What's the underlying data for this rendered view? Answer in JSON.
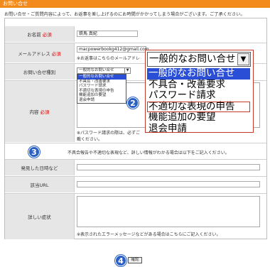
{
  "header": {
    "title": "お問い合せ"
  },
  "intro": "お問い合せ・ご質問内容によって、お返事を差し上げるのにお時間がかかってしまう場合がございます。ご了承ください。",
  "form": {
    "required_mark": "必須",
    "name": {
      "label": "お名前",
      "value": "鉄馬 真紀"
    },
    "email": {
      "label": "メールアドレス",
      "value": "macpowerbookg412@gmail.com",
      "note": "※お返事はこちらのメールアドレ"
    },
    "type": {
      "label": "お問い合せ種別",
      "selected": "一般的なお問い合せ",
      "options": [
        "一般的なお問い合せ",
        "不具合・改善要求",
        "パスワード請求",
        "不適切な表現の申告",
        "機能追加の要望",
        "退会申請"
      ]
    },
    "content": {
      "label": "内容",
      "note": "※パスワード請求の際は、必ずご",
      "note2": "載ください。"
    },
    "section_note": "不具合報告や不適切な表現など、詳しい情報がわかる場合は以下をご記入ください。",
    "found_datetime": {
      "label": "発見した日時など"
    },
    "url": {
      "label": "該当URL"
    },
    "detail": {
      "label": "詳しい症状",
      "note": "※表示されたエラーメッセージなどがある場合はこちらにご記入ください。"
    },
    "confirm_label": "確認"
  },
  "badges": {
    "two": "2",
    "three": "3",
    "four": "4"
  },
  "colors": {
    "header_bg": "#f28a1c",
    "required": "#e00000",
    "badge": "#2a5fc6",
    "highlight": "#2a4fd6",
    "callout_border": "#c23a2a"
  }
}
